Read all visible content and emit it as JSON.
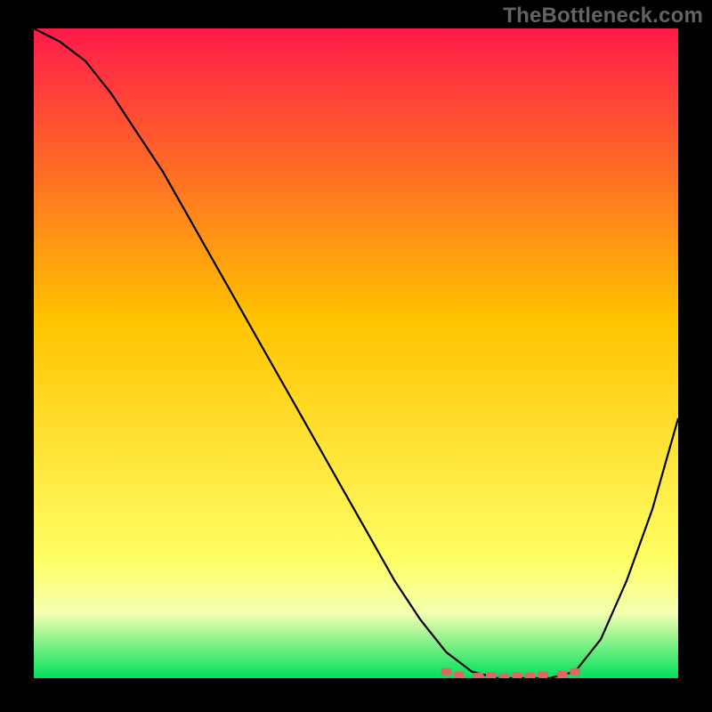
{
  "watermark": "TheBottleneck.com",
  "colors": {
    "bg_black": "#000000",
    "grad_top": "#ff1a4a",
    "grad_mid": "#ffc400",
    "grad_low": "#ffff66",
    "grad_bot": "#00e05a",
    "line": "#000000",
    "marker": "#e06666"
  },
  "chart_data": {
    "type": "line",
    "title": "",
    "xlabel": "",
    "ylabel": "",
    "xlim": [
      0,
      100
    ],
    "ylim": [
      0,
      100
    ],
    "series": [
      {
        "name": "bottleneck-curve",
        "x": [
          0,
          4,
          8,
          12,
          16,
          20,
          24,
          28,
          32,
          36,
          40,
          44,
          48,
          52,
          56,
          60,
          64,
          68,
          72,
          76,
          80,
          84,
          88,
          92,
          96,
          100
        ],
        "values": [
          100,
          98,
          95,
          90,
          84,
          78,
          71,
          64,
          57,
          50,
          43,
          36,
          29,
          22,
          15,
          9,
          4,
          1,
          0,
          0,
          0,
          1,
          6,
          15,
          26,
          40
        ]
      }
    ],
    "flat_region": {
      "x_start": 64,
      "x_end": 84,
      "y": 0
    },
    "markers": {
      "name": "optimal-zone",
      "points": [
        {
          "x": 64,
          "y": 1
        },
        {
          "x": 66,
          "y": 0.5
        },
        {
          "x": 69,
          "y": 0.3
        },
        {
          "x": 71,
          "y": 0.4
        },
        {
          "x": 73,
          "y": 0.2
        },
        {
          "x": 75,
          "y": 0.4
        },
        {
          "x": 77,
          "y": 0.3
        },
        {
          "x": 79,
          "y": 0.5
        },
        {
          "x": 82,
          "y": 0.6
        },
        {
          "x": 84,
          "y": 1
        }
      ]
    }
  }
}
